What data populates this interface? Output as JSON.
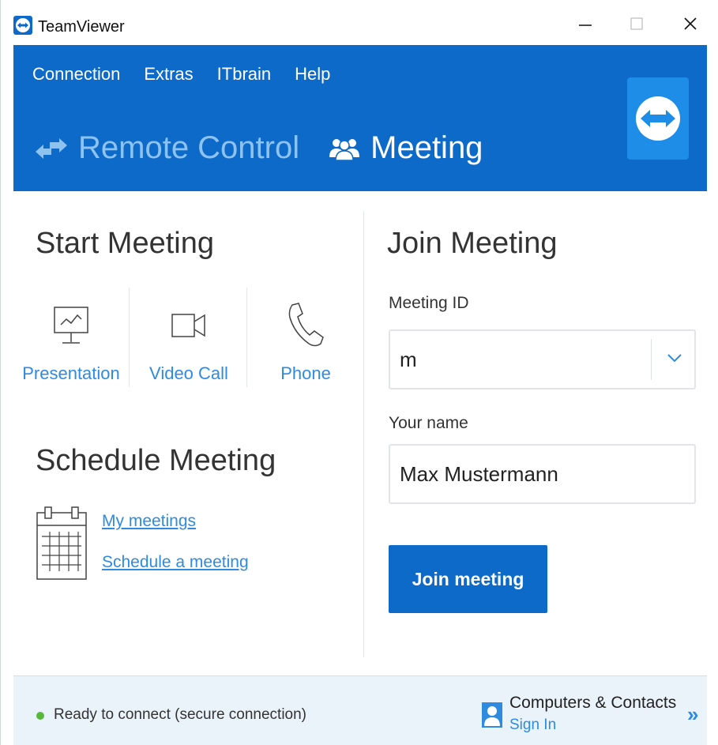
{
  "window": {
    "title": "TeamViewer"
  },
  "titlebar": {
    "minimize": "–",
    "maximize": "□",
    "close": "X"
  },
  "menu": {
    "items": [
      "Connection",
      "Extras",
      "ITbrain",
      "Help"
    ]
  },
  "mode_tabs": {
    "remote": "Remote Control",
    "meeting": "Meeting"
  },
  "start_meeting": {
    "title": "Start Meeting",
    "options": [
      {
        "label": "Presentation",
        "icon": "presentation-icon"
      },
      {
        "label": "Video Call",
        "icon": "video-camera-icon"
      },
      {
        "label": "Phone",
        "icon": "phone-icon"
      }
    ]
  },
  "schedule_meeting": {
    "title": "Schedule Meeting",
    "links": [
      "My meetings",
      "Schedule a meeting"
    ]
  },
  "join_meeting": {
    "title": "Join Meeting",
    "meeting_id_label": "Meeting ID",
    "meeting_id_value": "m",
    "name_label": "Your name",
    "name_value": "Max Mustermann",
    "button": "Join meeting"
  },
  "footer": {
    "status": "Ready to connect (secure connection)",
    "contacts_title": "Computers & Contacts",
    "sign_in": "Sign In",
    "expand": "»"
  },
  "colors": {
    "brand_blue": "#0e6ac8",
    "link_blue": "#2e8be0",
    "status_green": "#57b83a"
  }
}
